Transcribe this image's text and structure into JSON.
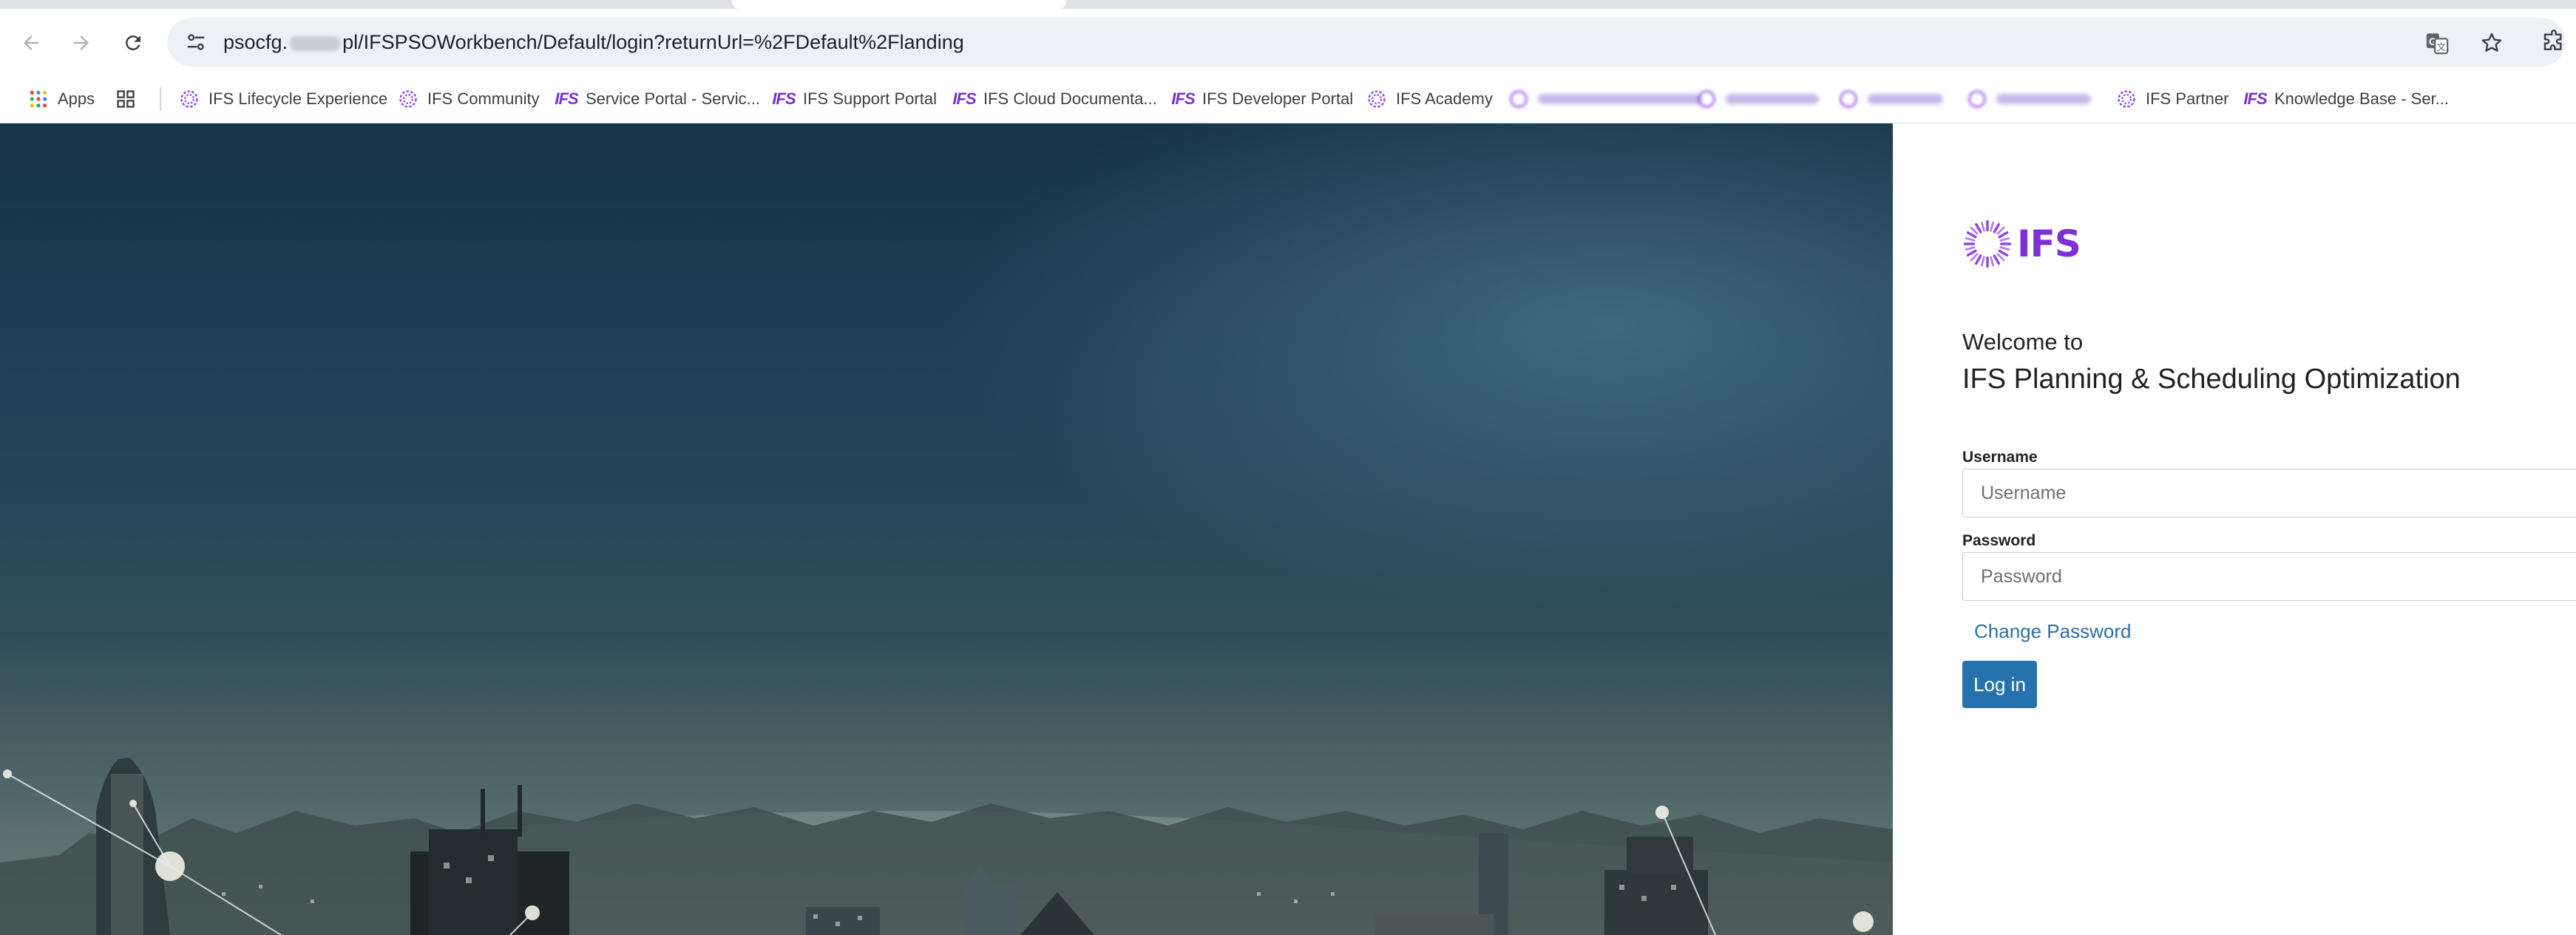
{
  "browser": {
    "url_prefix": "psocfg.",
    "url_suffix": "pl/IFSPSOWorkbench/Default/login?returnUrl=%2FDefault%2Flanding",
    "bookmarks": {
      "apps": "Apps",
      "items": [
        {
          "label": "IFS Lifecycle Experience",
          "icon": "ifs-swirl-icon"
        },
        {
          "label": "IFS Community",
          "icon": "ifs-swirl-icon"
        },
        {
          "label": "Service Portal - Servic...",
          "icon": "ifs-text-icon"
        },
        {
          "label": "IFS Support Portal",
          "icon": "ifs-text-icon"
        },
        {
          "label": "IFS Cloud Documenta...",
          "icon": "ifs-text-icon"
        },
        {
          "label": "IFS Developer Portal",
          "icon": "ifs-text-icon"
        },
        {
          "label": "IFS Academy",
          "icon": "ifs-swirl-icon"
        },
        {
          "label": "IFS Partner",
          "icon": "ifs-swirl-icon"
        },
        {
          "label": "Knowledge Base - Ser...",
          "icon": "ifs-text-icon"
        }
      ],
      "ifs_icon_text": "IFS"
    }
  },
  "login": {
    "logo_text": "IFS",
    "welcome": "Welcome to",
    "product": "IFS Planning & Scheduling Optimization",
    "username_label": "Username",
    "username_placeholder": "Username",
    "password_label": "Password",
    "password_placeholder": "Password",
    "change_password": "Change Password",
    "login_button": "Log in"
  },
  "colors": {
    "brand_purple": "#7e2fd8",
    "primary_button": "#2672ad",
    "link": "#2c6fa8"
  }
}
